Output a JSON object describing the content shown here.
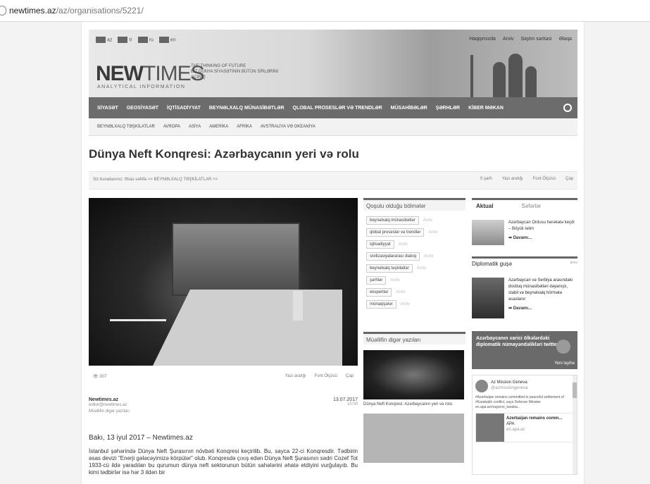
{
  "browser": {
    "host": "newtimes.az",
    "path": "/az/organisations/5221/"
  },
  "header": {
    "languages": [
      "az",
      "tr",
      "ru",
      "en"
    ],
    "toplinks": [
      "Haqqımızda",
      "Arxiv",
      "Saytın xəritəsi",
      "Əlaqə"
    ],
    "logo_bold": "NEW",
    "logo_light": "TIMES",
    "logo_sub": "ANALYTICAL INFORMATION",
    "tagline_1": "THE THINKING OF FUTURE",
    "tagline_2": "BİZ DÜNYA SİYASƏTİNİN BÜTÜN SİRLƏRİNİ AÇIRIQ"
  },
  "nav": {
    "items": [
      "SİYASƏT",
      "GEOSİYASƏT",
      "İQTİSADİYYAT",
      "BEYNƏLXALQ MÜNASİBƏTLƏR",
      "QLOBAL PROSESLƏR VƏ TRENDLƏR",
      "MÜSAHİBƏLƏR",
      "ŞƏRHLƏR",
      "KİBER MƏKAN"
    ],
    "sub": [
      "BEYNƏLXALQ TƏŞKİLATLAR",
      "AVROPA",
      "ASİYA",
      "AMERİKA",
      "AFRİKA",
      "AVSTRALİYA VƏ OKEANİYA"
    ]
  },
  "article": {
    "title": "Dünya Neft Konqresi: Azərbaycanın yeri və rolu",
    "crumb": "Siz buradasınız: Əsas səhifə >> BEYNƏLXALQ TƏŞKİLATLAR >>",
    "tools": {
      "comments": "0 şərh",
      "font_size": "Yazı aralığı",
      "font": "Font Ölçüsü",
      "print": "Çap"
    },
    "views": "307",
    "author_name": "Newtimes.az",
    "author_email": "editor@newtimes.az",
    "author_link": "Müəllifin digər yazıları",
    "date": "13.07.2017",
    "time": "10:00",
    "lead": "Bakı, 13 iyul 2017 – Newtimes.az",
    "body": "İstanbul şəhərində Dünya Neft Şurasının növbəti Konqresi keçirilib. Bu, sayca 22-ci Konqresdir. Tədbirin əsas devizi \"Enerji gələcəyimizə körpülər\" olub. Konqresdə çıxış edən Dünya Neft Şurasının sədri Cozef Tot 1933-cü ildə yaradılan bu qurumun dünya neft sektorunun bütün sahələrini əhatə etdiyini vurğulayıb. Bu kimi tədbirlər isə hər 3 ildən bir"
  },
  "middle": {
    "sections_title": "Qoşulu olduğu bölmələr",
    "tags": [
      "beynəlxalq münasibətlər",
      "qlobal proseslər və trendlər",
      "iqtisadiyyat",
      "sivilizasiyalararası dialoq",
      "beynəlxalq təşkilatlar",
      "şərhlər",
      "ekspertlər",
      "münaqişələr"
    ],
    "tag_more": "Arxiv",
    "author_title": "Müəllifin digər yazıları",
    "thumb_caption": "Dünya Neft Konqresi: Azərbaycanın yeri və rolu"
  },
  "right": {
    "tab_active": "Aktual",
    "tab_other": "Səfərlər",
    "news1": "Azərbaycan Ordusu hərəkətə keçdi – Böyük təlim",
    "more": "Davamı...",
    "dip_title": "Diplomatik guşə",
    "dip_arx": "arxiv",
    "news2": "Azərbaycan və Serbiya arasındakı dostluq münasibətləri dəyanışlı, stabil və beynəlxalq hörmətə əsaslanır",
    "banner": "Azərbaycanın xarici ölkələrdəki diplomatik nümayəndəlikləri twitterdə",
    "banner_new": "Yeni layihə",
    "tw_name": "Az Mission Geneva",
    "tw_handle": "@azmissiongeneva",
    "tw_text": "#Azerbaijan remains committed to peaceful settlement of #Karabakh conflict, says Defense Minister en.apa.az/nagorno_karaba...",
    "tw_card_title": "Azerbaijan remains comm...",
    "tw_card_source": "APA",
    "tw_card_url": "en.apa.az"
  }
}
